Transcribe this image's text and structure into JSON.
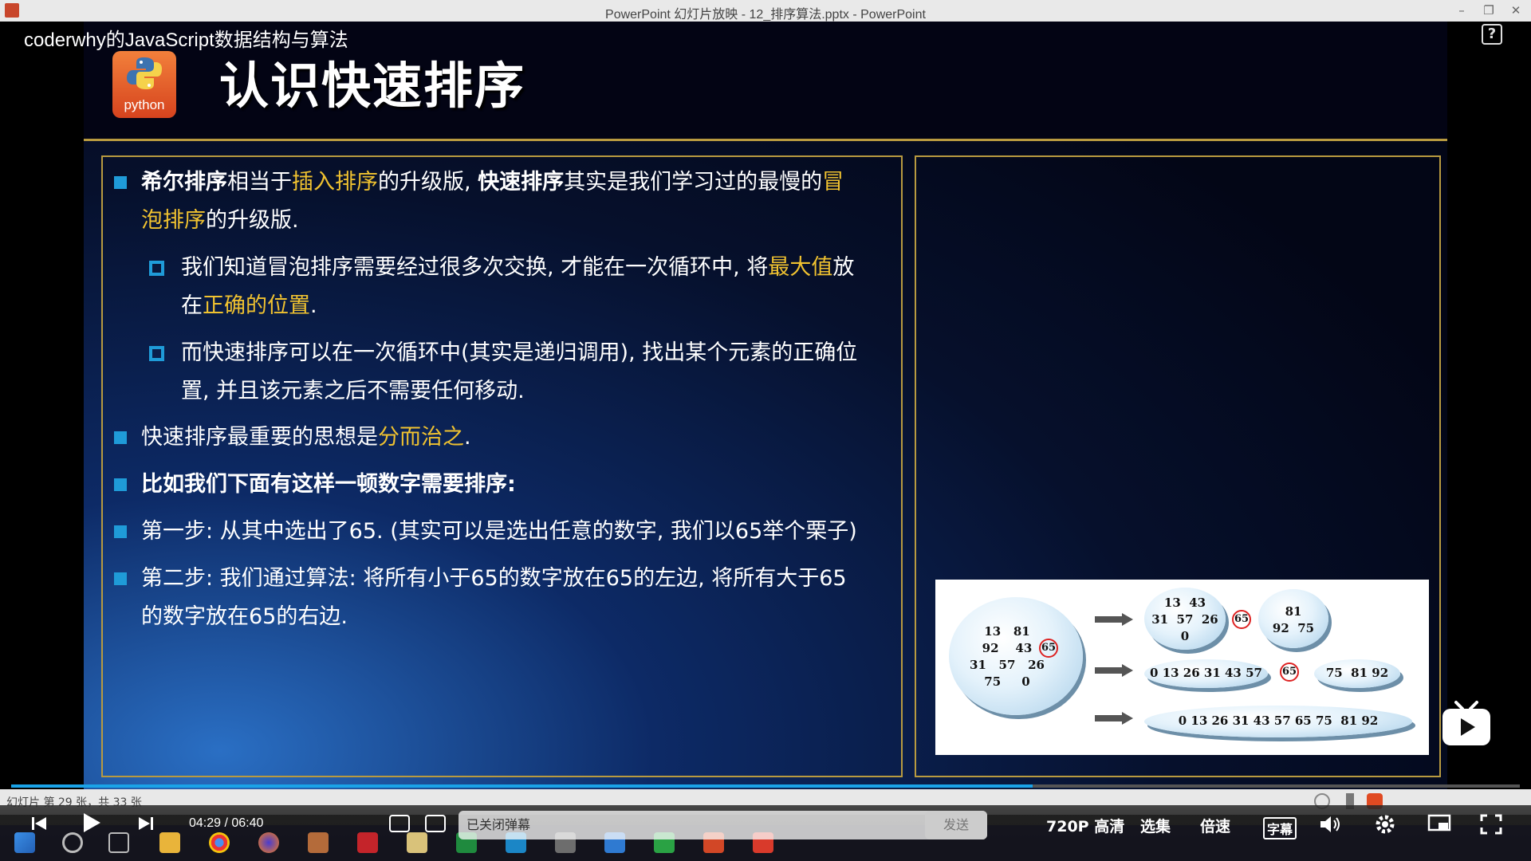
{
  "window": {
    "title": "PowerPoint 幻灯片放映  -  12_排序算法.pptx - PowerPoint",
    "minimize": "–",
    "restore": "❐",
    "close": "✕"
  },
  "overlay": {
    "course_title": "coderwhy的JavaScript数据结构与算法",
    "help": "?"
  },
  "slide": {
    "logo_text": "python",
    "title": "认识快速排序",
    "bullets": {
      "b1": {
        "p1": "希尔排序",
        "p2": "相当于",
        "p3": "插入排序",
        "p4": "的升级版, ",
        "p5": "快速排序",
        "p6": "其实是我们学习过的最慢的",
        "p7": "冒",
        "p8": "泡排序",
        "p9": "的升级版."
      },
      "s1": {
        "p1": "我们知道冒泡排序需要经过很多次交换, 才能在一次循环中, 将",
        "p2": "最大值",
        "p3": "放",
        "p4": "在",
        "p5": "正确的位置",
        "p6": "."
      },
      "s2": {
        "l1": "而快速排序可以在一次循环中(其实是递归调用), 找出某个元素的正确位",
        "l2": "置, 并且该元素之后不需要任何移动."
      },
      "b2": {
        "p1": "快速排序最重要的思想是",
        "p2": "分而治之",
        "p3": "."
      },
      "b3": "比如我们下面有这样一顿数字需要排序:",
      "b4": "第一步: 从其中选出了65. (其实可以是选出任意的数字, 我们以65举个栗子)",
      "b5": {
        "l1": "第二步: 我们通过算法: 将所有小于65的数字放在65的左边, 将所有大于65",
        "l2": "的数字放在65的右边."
      }
    },
    "diagram": {
      "initial": "13   81\n92    43\n31   57   26\n75     0",
      "pivot": "65",
      "row1_left": "13  43\n31  57  26\n0",
      "row1_right": "81\n92  75",
      "row2_left": "0 13 26 31 43 57",
      "row2_right": "75  81 92",
      "row3": "0 13 26 31 43 57 65 75  81 92"
    }
  },
  "player": {
    "status": "幻灯片 第 29 张，共 33 张",
    "progress": 0.677,
    "time": "04:29 / 06:40",
    "danmaku_placeholder": "已关闭弹幕",
    "send": "发送",
    "quality": "720P 高清",
    "episodes": "选集",
    "speed": "倍速",
    "subtitle": "字幕"
  },
  "colors": {
    "accent_blue": "#1f9bd8",
    "highlight_yellow": "#f0c230",
    "border_gold": "#b89a40",
    "progress_blue": "#1aa3e8"
  }
}
